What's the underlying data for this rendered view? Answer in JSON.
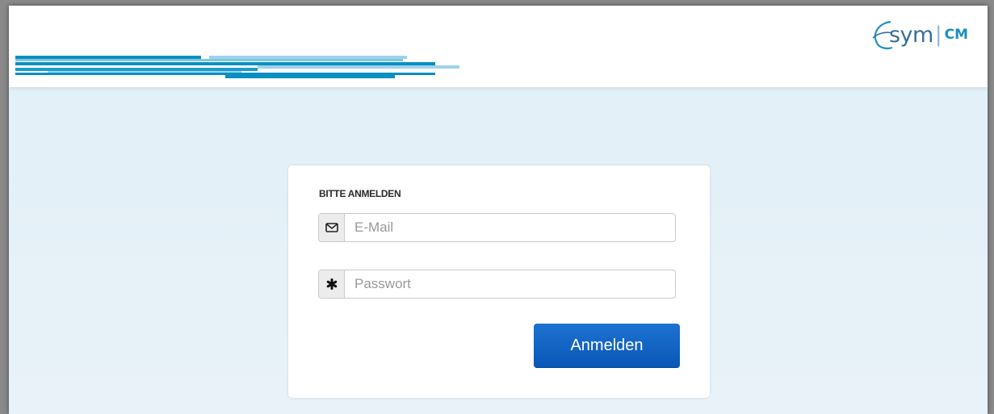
{
  "brand": {
    "logo_sym": "sym",
    "logo_separator": "|",
    "logo_cm": "CM"
  },
  "login": {
    "title": "BITTE ANMELDEN",
    "email_placeholder": "E-Mail",
    "email_value": "",
    "password_placeholder": "Passwort",
    "password_value": "",
    "submit_label": "Anmelden"
  },
  "icons": {
    "email": "envelope-icon",
    "password": "asterisk-icon",
    "logo_swoosh": "swoosh-icon"
  },
  "colors": {
    "primary_button": "#1d73d2",
    "stripe_dark": "#0b8fc0",
    "stripe_light": "#9fd2ea",
    "logo_cm": "#1a8fc4"
  }
}
